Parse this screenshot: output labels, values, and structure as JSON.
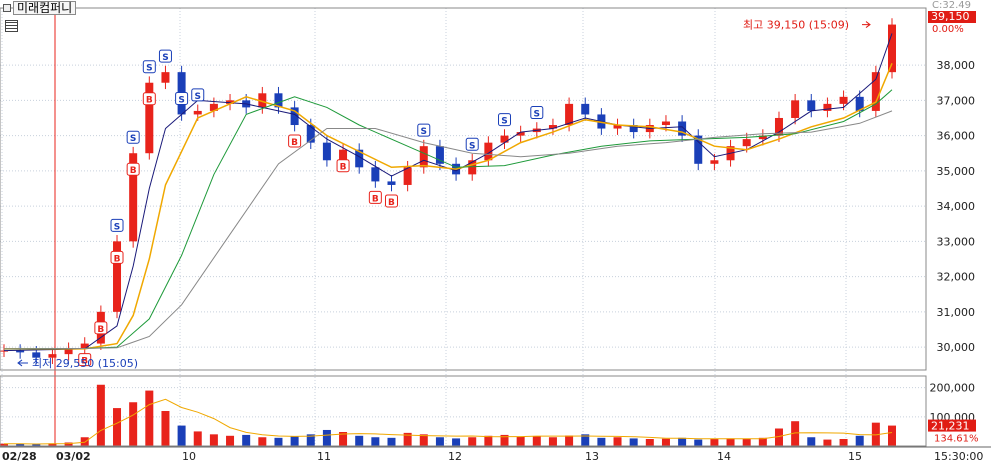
{
  "window": {
    "title": "미래컴퍼니",
    "table_icon": "table-icon",
    "settings_icon": "small-square-icon"
  },
  "colors": {
    "up": "#e8231b",
    "down": "#1a3fb8",
    "ma5": "#1a1a7a",
    "ma20": "#f0a800",
    "ma60": "#1e9a3a",
    "ma120": "#888888",
    "grid": "#c8d0dc",
    "current_price_box": "#e01c14",
    "volume_box": "#e01c14"
  },
  "header_right": {
    "change_label": "C:32.49",
    "current_price": "39,150",
    "change_pct": "0.00%"
  },
  "chart_data": {
    "type": "line",
    "title": "미래컴퍼니",
    "panels": [
      "price",
      "volume"
    ],
    "x_tick_labels": [
      "02/28",
      "03/02",
      "10",
      "11",
      "12",
      "13",
      "14",
      "15",
      "15:30:00"
    ],
    "y_price_ticks": [
      "38,000",
      "37,000",
      "36,000",
      "35,000",
      "34,000",
      "33,000",
      "32,000",
      "31,000",
      "30,000"
    ],
    "y_price_values": [
      38000,
      37000,
      36000,
      35000,
      34000,
      33000,
      32000,
      31000,
      30000
    ],
    "ylim_price": [
      29350,
      39620
    ],
    "y_volume_ticks": [
      "200,000",
      "100,000"
    ],
    "y_volume_values": [
      200000,
      100000
    ],
    "ylim_volume": [
      0,
      240000
    ],
    "annotations": {
      "high": {
        "label": "최고 39,150 (15:09)",
        "value": 39150
      },
      "low": {
        "label": "최저 29,550 (15:05)",
        "value": 29550
      }
    },
    "volume_last": "21,231",
    "volume_ratio": "134.61%",
    "grid": true,
    "series": [
      {
        "key": "close",
        "x": [
          0,
          1,
          2,
          3,
          4,
          5,
          6,
          7,
          8,
          9,
          10,
          11,
          12,
          13,
          14,
          15,
          16,
          17,
          18,
          19,
          20,
          21,
          22,
          23,
          24,
          25,
          26,
          27,
          28,
          29,
          30,
          31,
          32,
          33,
          34,
          35,
          36,
          37,
          38,
          39,
          40,
          41,
          42,
          43,
          44,
          45,
          46,
          47,
          48,
          49,
          50,
          51,
          52,
          53,
          54,
          55
        ],
        "values": [
          29900,
          29850,
          29700,
          29800,
          29950,
          30100,
          31000,
          33000,
          35500,
          37500,
          37800,
          36600,
          36700,
          36900,
          37000,
          36800,
          37200,
          36800,
          36300,
          35800,
          35300,
          35600,
          35100,
          34700,
          34600,
          35100,
          35700,
          35200,
          34900,
          35300,
          35800,
          36000,
          36100,
          36200,
          36300,
          36900,
          36600,
          36200,
          36300,
          36100,
          36300,
          36400,
          36000,
          35200,
          35300,
          35700,
          35900,
          36000,
          36500,
          37000,
          36700,
          36900,
          37100,
          36700,
          37800,
          39150
        ]
      },
      {
        "key": "ma5",
        "x": [
          0,
          5,
          7,
          8,
          9,
          10,
          12,
          15,
          18,
          20,
          22,
          24,
          26,
          28,
          30,
          32,
          34,
          36,
          38,
          40,
          42,
          44,
          46,
          48,
          50,
          52,
          54,
          55
        ],
        "values": [
          29900,
          29950,
          30600,
          32300,
          34500,
          36200,
          37000,
          36900,
          36600,
          35900,
          35400,
          34850,
          35300,
          35000,
          35500,
          36100,
          36200,
          36500,
          36300,
          36200,
          36250,
          35400,
          35600,
          36100,
          36700,
          36800,
          37600,
          38900
        ]
      },
      {
        "key": "ma20",
        "x": [
          0,
          5,
          7,
          8,
          9,
          10,
          12,
          15,
          18,
          20,
          22,
          24,
          26,
          28,
          30,
          32,
          34,
          36,
          38,
          40,
          42,
          44,
          46,
          48,
          50,
          52,
          54,
          55
        ],
        "values": [
          29950,
          29950,
          30100,
          30900,
          32500,
          34600,
          36500,
          37100,
          36700,
          36000,
          35550,
          35100,
          35150,
          35050,
          35300,
          35800,
          36100,
          36450,
          36300,
          36250,
          36100,
          35700,
          35600,
          35900,
          36250,
          36500,
          36950,
          38050
        ]
      },
      {
        "key": "ma60",
        "x": [
          0,
          5,
          7,
          9,
          11,
          13,
          15,
          18,
          20,
          22,
          25,
          28,
          31,
          34,
          37,
          40,
          43,
          46,
          49,
          52,
          54,
          55
        ],
        "values": [
          29950,
          29960,
          30000,
          30800,
          32600,
          34900,
          36600,
          37100,
          36800,
          36300,
          35700,
          35100,
          35150,
          35450,
          35700,
          35850,
          35900,
          35950,
          36050,
          36400,
          36900,
          37300
        ]
      },
      {
        "key": "ma120",
        "x": [
          0,
          5,
          7,
          9,
          11,
          14,
          17,
          20,
          23,
          26,
          29,
          32,
          35,
          38,
          41,
          44,
          47,
          50,
          53,
          55
        ],
        "values": [
          29950,
          29960,
          29980,
          30300,
          31200,
          33200,
          35200,
          36200,
          36200,
          35800,
          35500,
          35400,
          35500,
          35700,
          35800,
          35950,
          36050,
          36100,
          36350,
          36700
        ]
      }
    ],
    "volume_bars": [
      8,
      7,
      6,
      9,
      12,
      30,
      210,
      130,
      150,
      190,
      120,
      70,
      50,
      40,
      35,
      38,
      30,
      28,
      34,
      40,
      55,
      48,
      35,
      30,
      28,
      45,
      40,
      30,
      26,
      30,
      35,
      38,
      32,
      34,
      30,
      36,
      40,
      28,
      30,
      26,
      24,
      25,
      28,
      22,
      24,
      26,
      25,
      28,
      60,
      85,
      30,
      22,
      24,
      35,
      80,
      70
    ],
    "signals": {
      "buy": [
        5,
        6,
        7,
        8,
        9,
        18,
        21,
        23,
        24
      ],
      "sell": [
        7,
        8,
        9,
        10,
        11,
        12,
        26,
        29,
        31,
        33
      ]
    }
  }
}
